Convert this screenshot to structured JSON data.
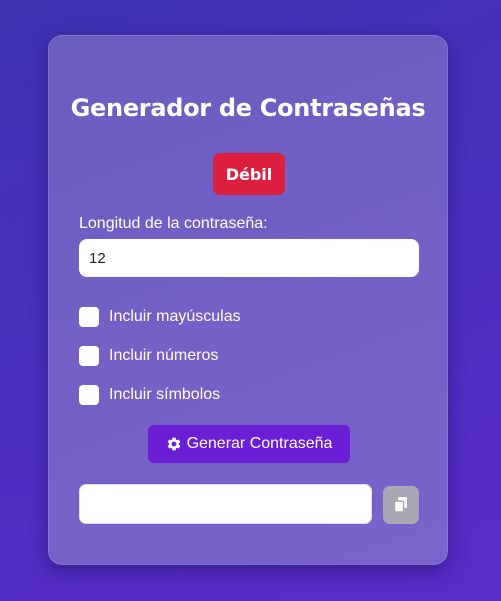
{
  "app": {
    "title": "Generador de Contraseñas"
  },
  "strength": {
    "label": "Débil",
    "color": "#dc1f3f"
  },
  "length": {
    "label": "Longitud de la contraseña:",
    "value": "12"
  },
  "options": [
    {
      "label": "Incluir mayúsculas",
      "checked": false
    },
    {
      "label": "Incluir números",
      "checked": false
    },
    {
      "label": "Incluir símbolos",
      "checked": false
    }
  ],
  "generate": {
    "label": "Generar Contraseña",
    "icon": "gear-icon"
  },
  "output": {
    "value": "",
    "copy_icon": "copy-icon"
  },
  "colors": {
    "accent": "#6a1fd6",
    "card": "#7060c4",
    "background": "#4a2fbf",
    "copy_button": "#a9a7b3"
  }
}
